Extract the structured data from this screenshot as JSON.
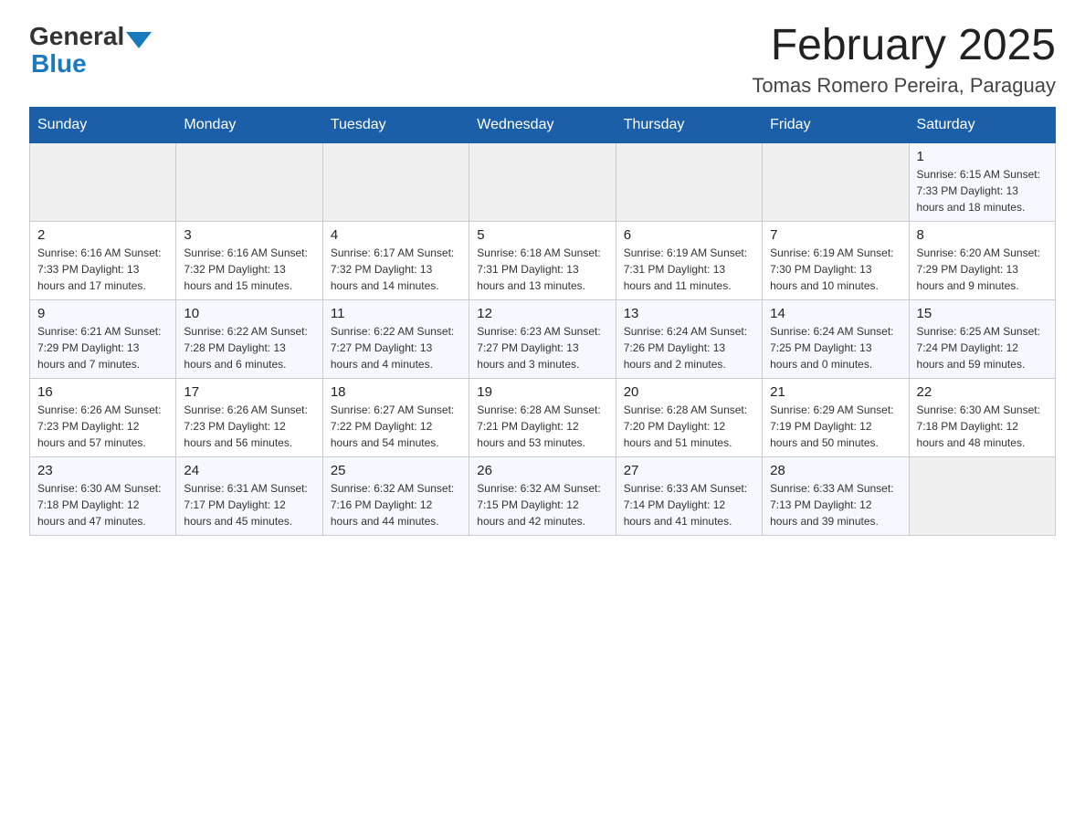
{
  "header": {
    "logo_general": "General",
    "logo_blue": "Blue",
    "main_title": "February 2025",
    "subtitle": "Tomas Romero Pereira, Paraguay"
  },
  "days_of_week": [
    "Sunday",
    "Monday",
    "Tuesday",
    "Wednesday",
    "Thursday",
    "Friday",
    "Saturday"
  ],
  "weeks": [
    {
      "days": [
        {
          "num": "",
          "info": "",
          "empty": true
        },
        {
          "num": "",
          "info": "",
          "empty": true
        },
        {
          "num": "",
          "info": "",
          "empty": true
        },
        {
          "num": "",
          "info": "",
          "empty": true
        },
        {
          "num": "",
          "info": "",
          "empty": true
        },
        {
          "num": "",
          "info": "",
          "empty": true
        },
        {
          "num": "1",
          "info": "Sunrise: 6:15 AM\nSunset: 7:33 PM\nDaylight: 13 hours\nand 18 minutes.",
          "empty": false
        }
      ]
    },
    {
      "days": [
        {
          "num": "2",
          "info": "Sunrise: 6:16 AM\nSunset: 7:33 PM\nDaylight: 13 hours\nand 17 minutes.",
          "empty": false
        },
        {
          "num": "3",
          "info": "Sunrise: 6:16 AM\nSunset: 7:32 PM\nDaylight: 13 hours\nand 15 minutes.",
          "empty": false
        },
        {
          "num": "4",
          "info": "Sunrise: 6:17 AM\nSunset: 7:32 PM\nDaylight: 13 hours\nand 14 minutes.",
          "empty": false
        },
        {
          "num": "5",
          "info": "Sunrise: 6:18 AM\nSunset: 7:31 PM\nDaylight: 13 hours\nand 13 minutes.",
          "empty": false
        },
        {
          "num": "6",
          "info": "Sunrise: 6:19 AM\nSunset: 7:31 PM\nDaylight: 13 hours\nand 11 minutes.",
          "empty": false
        },
        {
          "num": "7",
          "info": "Sunrise: 6:19 AM\nSunset: 7:30 PM\nDaylight: 13 hours\nand 10 minutes.",
          "empty": false
        },
        {
          "num": "8",
          "info": "Sunrise: 6:20 AM\nSunset: 7:29 PM\nDaylight: 13 hours\nand 9 minutes.",
          "empty": false
        }
      ]
    },
    {
      "days": [
        {
          "num": "9",
          "info": "Sunrise: 6:21 AM\nSunset: 7:29 PM\nDaylight: 13 hours\nand 7 minutes.",
          "empty": false
        },
        {
          "num": "10",
          "info": "Sunrise: 6:22 AM\nSunset: 7:28 PM\nDaylight: 13 hours\nand 6 minutes.",
          "empty": false
        },
        {
          "num": "11",
          "info": "Sunrise: 6:22 AM\nSunset: 7:27 PM\nDaylight: 13 hours\nand 4 minutes.",
          "empty": false
        },
        {
          "num": "12",
          "info": "Sunrise: 6:23 AM\nSunset: 7:27 PM\nDaylight: 13 hours\nand 3 minutes.",
          "empty": false
        },
        {
          "num": "13",
          "info": "Sunrise: 6:24 AM\nSunset: 7:26 PM\nDaylight: 13 hours\nand 2 minutes.",
          "empty": false
        },
        {
          "num": "14",
          "info": "Sunrise: 6:24 AM\nSunset: 7:25 PM\nDaylight: 13 hours\nand 0 minutes.",
          "empty": false
        },
        {
          "num": "15",
          "info": "Sunrise: 6:25 AM\nSunset: 7:24 PM\nDaylight: 12 hours\nand 59 minutes.",
          "empty": false
        }
      ]
    },
    {
      "days": [
        {
          "num": "16",
          "info": "Sunrise: 6:26 AM\nSunset: 7:23 PM\nDaylight: 12 hours\nand 57 minutes.",
          "empty": false
        },
        {
          "num": "17",
          "info": "Sunrise: 6:26 AM\nSunset: 7:23 PM\nDaylight: 12 hours\nand 56 minutes.",
          "empty": false
        },
        {
          "num": "18",
          "info": "Sunrise: 6:27 AM\nSunset: 7:22 PM\nDaylight: 12 hours\nand 54 minutes.",
          "empty": false
        },
        {
          "num": "19",
          "info": "Sunrise: 6:28 AM\nSunset: 7:21 PM\nDaylight: 12 hours\nand 53 minutes.",
          "empty": false
        },
        {
          "num": "20",
          "info": "Sunrise: 6:28 AM\nSunset: 7:20 PM\nDaylight: 12 hours\nand 51 minutes.",
          "empty": false
        },
        {
          "num": "21",
          "info": "Sunrise: 6:29 AM\nSunset: 7:19 PM\nDaylight: 12 hours\nand 50 minutes.",
          "empty": false
        },
        {
          "num": "22",
          "info": "Sunrise: 6:30 AM\nSunset: 7:18 PM\nDaylight: 12 hours\nand 48 minutes.",
          "empty": false
        }
      ]
    },
    {
      "days": [
        {
          "num": "23",
          "info": "Sunrise: 6:30 AM\nSunset: 7:18 PM\nDaylight: 12 hours\nand 47 minutes.",
          "empty": false
        },
        {
          "num": "24",
          "info": "Sunrise: 6:31 AM\nSunset: 7:17 PM\nDaylight: 12 hours\nand 45 minutes.",
          "empty": false
        },
        {
          "num": "25",
          "info": "Sunrise: 6:32 AM\nSunset: 7:16 PM\nDaylight: 12 hours\nand 44 minutes.",
          "empty": false
        },
        {
          "num": "26",
          "info": "Sunrise: 6:32 AM\nSunset: 7:15 PM\nDaylight: 12 hours\nand 42 minutes.",
          "empty": false
        },
        {
          "num": "27",
          "info": "Sunrise: 6:33 AM\nSunset: 7:14 PM\nDaylight: 12 hours\nand 41 minutes.",
          "empty": false
        },
        {
          "num": "28",
          "info": "Sunrise: 6:33 AM\nSunset: 7:13 PM\nDaylight: 12 hours\nand 39 minutes.",
          "empty": false
        },
        {
          "num": "",
          "info": "",
          "empty": true
        }
      ]
    }
  ]
}
